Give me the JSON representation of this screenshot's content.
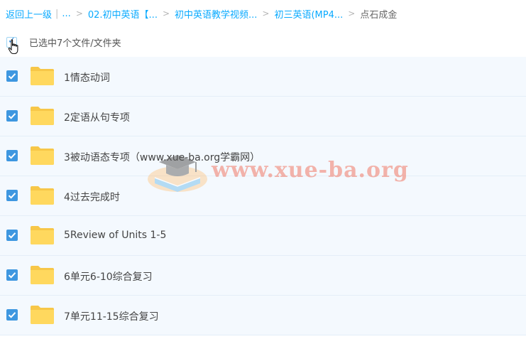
{
  "breadcrumb": {
    "back": "返回上一级",
    "pipe": "|",
    "ellipsis": "...",
    "separator": ">",
    "items": [
      "02.初中英语【...",
      "初中英语教学视频...",
      "初三英语(MP4..."
    ],
    "current": "点石成金"
  },
  "selection": {
    "label": "已选中7个文件/文件夹",
    "check_glyph": "✓"
  },
  "files": [
    {
      "name": "1情态动词",
      "checked": true
    },
    {
      "name": "2定语从句专项",
      "checked": true
    },
    {
      "name": "3被动语态专项（www.xue-ba.org学霸网）",
      "checked": true
    },
    {
      "name": "4过去完成时",
      "checked": true
    },
    {
      "name": "5Review of Units 1-5",
      "checked": true
    },
    {
      "name": "6单元6-10综合复习",
      "checked": true
    },
    {
      "name": "7单元11-15综合复习",
      "checked": true
    }
  ],
  "watermark": {
    "text": "www.xue-ba.org",
    "logo": "graduation-cap-book-logo"
  },
  "icons": {
    "folder": "folder-icon",
    "checkbox": "checkbox-checked-icon",
    "cursor": "hand-pointer-icon"
  },
  "colors": {
    "link": "#09aaff",
    "checkbox": "#3e97e0",
    "folder": "#ffd85e",
    "row_bg": "#f4f9fe",
    "watermark": "#f07864"
  }
}
